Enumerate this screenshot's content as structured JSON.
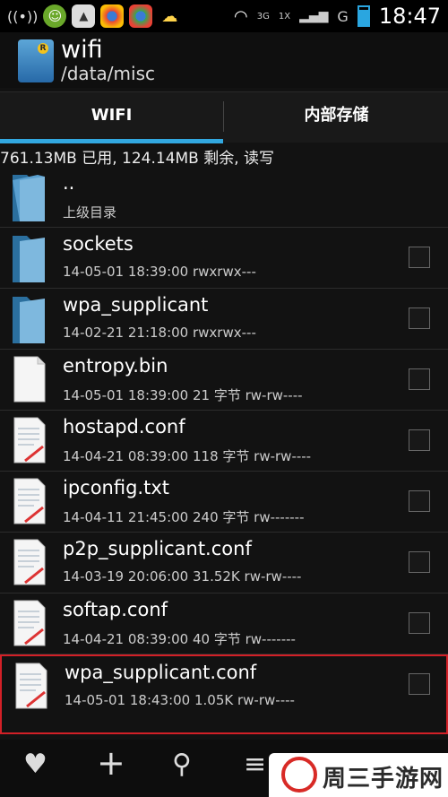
{
  "status_bar": {
    "network_labels": [
      "3G",
      "1X",
      "G"
    ],
    "time": "18:47"
  },
  "app": {
    "title": "wifi",
    "path": "/data/misc"
  },
  "tabs": [
    {
      "label": "WIFI",
      "active": true
    },
    {
      "label": "内部存储",
      "active": false
    }
  ],
  "storage_info": "761.13MB 已用, 124.14MB 剩余, 读写",
  "files": [
    {
      "name": "..",
      "meta": "上级目录",
      "type": "folder",
      "checkbox": false
    },
    {
      "name": "sockets",
      "meta": "14-05-01 18:39:00  rwxrwx---",
      "type": "folder",
      "checkbox": true
    },
    {
      "name": "wpa_supplicant",
      "meta": "14-02-21 21:18:00  rwxrwx---",
      "type": "folder",
      "checkbox": true
    },
    {
      "name": "entropy.bin",
      "meta": "14-05-01 18:39:00 21 字节  rw-rw----",
      "type": "binary",
      "checkbox": true
    },
    {
      "name": "hostapd.conf",
      "meta": "14-04-21 08:39:00 118 字节  rw-rw----",
      "type": "text",
      "checkbox": true
    },
    {
      "name": "ipconfig.txt",
      "meta": "14-04-11 21:45:00 240 字节  rw-------",
      "type": "text",
      "checkbox": true
    },
    {
      "name": "p2p_supplicant.conf",
      "meta": "14-03-19 20:06:00 31.52K  rw-rw----",
      "type": "text",
      "checkbox": true
    },
    {
      "name": "softap.conf",
      "meta": "14-04-21 08:39:00 40 字节  rw-------",
      "type": "text",
      "checkbox": true
    },
    {
      "name": "wpa_supplicant.conf",
      "meta": "14-05-01 18:43:00 1.05K  rw-rw----",
      "type": "text",
      "checkbox": true,
      "highlighted": true
    }
  ],
  "bottom_actions": [
    "heart-icon",
    "add-icon",
    "search-icon",
    "menu-icon"
  ],
  "watermark": "周三手游网",
  "colors": {
    "accent": "#32a8e0",
    "highlight_border": "#d32027"
  }
}
